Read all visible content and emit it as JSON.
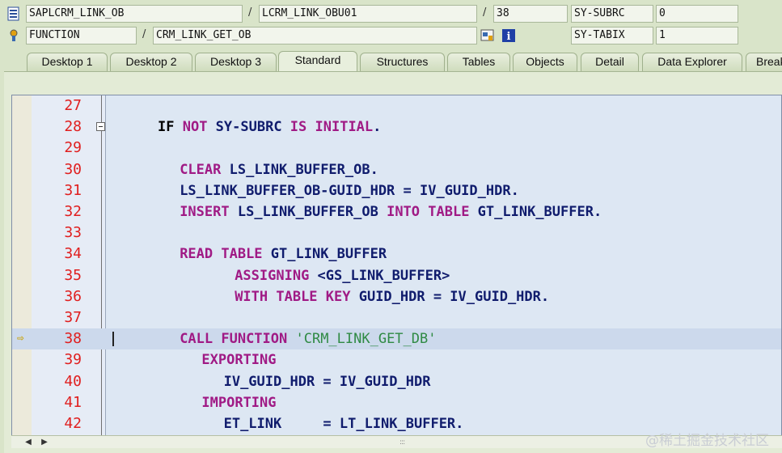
{
  "header": {
    "program": "SAPLCRM_LINK_OB",
    "include": "LCRM_LINK_OBU01",
    "line": "38",
    "event_type": "FUNCTION",
    "event_name": "CRM_LINK_GET_OB",
    "sys_fields": [
      {
        "name": "SY-SUBRC",
        "value": "0"
      },
      {
        "name": "SY-TABIX",
        "value": "1"
      }
    ]
  },
  "tabs": [
    {
      "label": "Desktop 1"
    },
    {
      "label": "Desktop 2"
    },
    {
      "label": "Desktop 3"
    },
    {
      "label": "Standard",
      "active": true
    },
    {
      "label": "Structures"
    },
    {
      "label": "Tables"
    },
    {
      "label": "Objects"
    },
    {
      "label": "Detail"
    },
    {
      "label": "Data Explorer"
    },
    {
      "label": "Break"
    }
  ],
  "code": {
    "current_line": "38",
    "lines": [
      {
        "n": "27",
        "tokens": []
      },
      {
        "n": "28",
        "indent": 0,
        "tokens": [
          [
            "plain",
            "IF "
          ],
          [
            "kw",
            "NOT "
          ],
          [
            "id",
            "SY-SUBRC "
          ],
          [
            "kw",
            "IS INITIAL"
          ],
          [
            "id",
            "."
          ]
        ]
      },
      {
        "n": "29",
        "tokens": []
      },
      {
        "n": "30",
        "indent": 2,
        "tokens": [
          [
            "kw",
            "CLEAR "
          ],
          [
            "id",
            "LS_LINK_BUFFER_OB."
          ]
        ]
      },
      {
        "n": "31",
        "indent": 2,
        "tokens": [
          [
            "id",
            "LS_LINK_BUFFER_OB-GUID_HDR = IV_GUID_HDR."
          ]
        ]
      },
      {
        "n": "32",
        "indent": 2,
        "tokens": [
          [
            "kw",
            "INSERT "
          ],
          [
            "id",
            "LS_LINK_BUFFER_OB "
          ],
          [
            "kw",
            "INTO TABLE "
          ],
          [
            "id",
            "GT_LINK_BUFFER."
          ]
        ]
      },
      {
        "n": "33",
        "tokens": []
      },
      {
        "n": "34",
        "indent": 2,
        "tokens": [
          [
            "kw",
            "READ TABLE "
          ],
          [
            "id",
            "GT_LINK_BUFFER"
          ]
        ]
      },
      {
        "n": "35",
        "indent": 7,
        "tokens": [
          [
            "kw",
            "ASSIGNING "
          ],
          [
            "id",
            "<GS_LINK_BUFFER>"
          ]
        ]
      },
      {
        "n": "36",
        "indent": 7,
        "tokens": [
          [
            "kw",
            "WITH TABLE KEY "
          ],
          [
            "id",
            "GUID_HDR = IV_GUID_HDR."
          ]
        ]
      },
      {
        "n": "37",
        "tokens": []
      },
      {
        "n": "38",
        "indent": 2,
        "tokens": [
          [
            "kw",
            "CALL FUNCTION "
          ],
          [
            "str",
            "'CRM_LINK_GET_DB'"
          ]
        ]
      },
      {
        "n": "39",
        "indent": 4,
        "tokens": [
          [
            "kw",
            "EXPORTING"
          ]
        ]
      },
      {
        "n": "40",
        "indent": 6,
        "tokens": [
          [
            "id",
            "IV_GUID_HDR = IV_GUID_HDR"
          ]
        ]
      },
      {
        "n": "41",
        "indent": 4,
        "tokens": [
          [
            "kw",
            "IMPORTING"
          ]
        ]
      },
      {
        "n": "42",
        "indent": 6,
        "tokens": [
          [
            "id",
            "ET_LINK     = LT_LINK_BUFFER."
          ]
        ]
      }
    ]
  },
  "watermark": "@稀土掘金技术社区"
}
